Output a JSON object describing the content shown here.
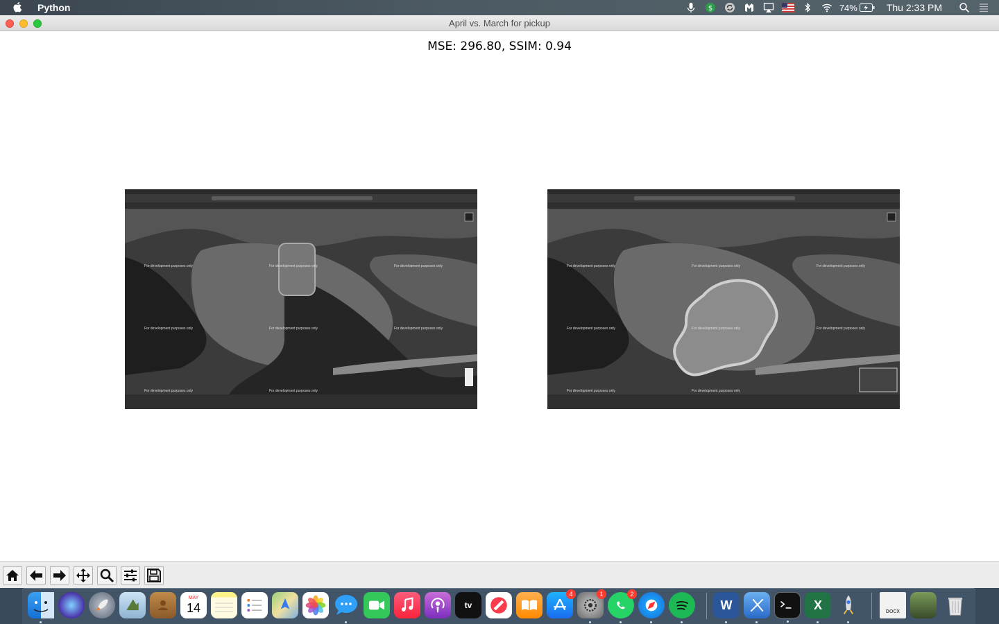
{
  "menubar": {
    "app_name": "Python",
    "battery_percent": "74%",
    "clock": "Thu 2:33 PM"
  },
  "window": {
    "title": "April vs. March for pickup"
  },
  "figure": {
    "title": "MSE: 296.80, SSIM: 0.94",
    "panels": [
      {
        "watermark": "For development purposes only"
      },
      {
        "watermark": "For development purposes only"
      }
    ]
  },
  "toolbar": {
    "buttons": [
      "home",
      "back",
      "forward",
      "pan",
      "zoom",
      "configure-subplots",
      "save"
    ]
  },
  "dock": {
    "calendar_month": "MAY",
    "calendar_day": "14",
    "appstore_badge": "4",
    "settings_badge": "1",
    "whatsapp_badge": "2",
    "word_letter": "W",
    "excel_letter": "X",
    "file_label": "DOCX"
  }
}
